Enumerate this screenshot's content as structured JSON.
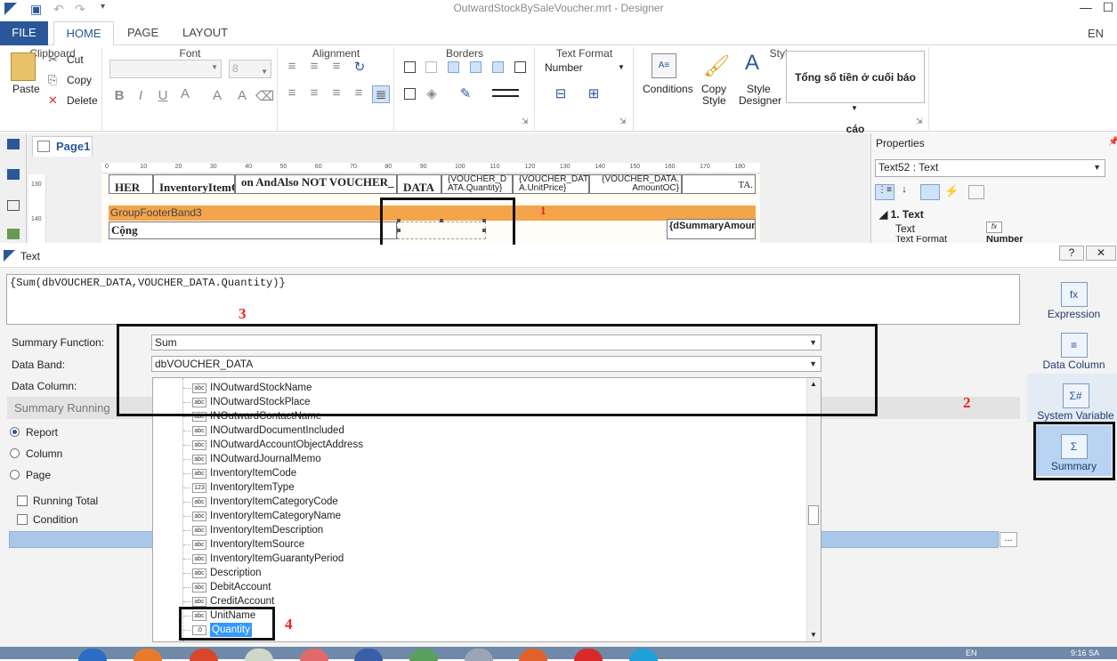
{
  "window": {
    "title": "OutwardStockBySaleVoucher.mrt - Designer",
    "lang": "EN"
  },
  "ribbon": {
    "tabs": [
      {
        "label": "FILE"
      },
      {
        "label": "HOME"
      },
      {
        "label": "PAGE"
      },
      {
        "label": "LAYOUT"
      }
    ],
    "clipboard": {
      "paste": "Paste",
      "cut": "Cut",
      "copy": "Copy",
      "delete": "Delete",
      "group": "Clipboard"
    },
    "font": {
      "size": "8",
      "group": "Font"
    },
    "alignment": {
      "group": "Alignment"
    },
    "borders": {
      "group": "Borders"
    },
    "text_format": {
      "format": "Number",
      "group": "Text Format"
    },
    "style": {
      "conditions": "Conditions",
      "copy_style_1": "Copy",
      "copy_style_2": "Style",
      "style_designer_1": "Style",
      "style_designer_2": "Designer",
      "preview": "Tổng số tiền ở cuối báo cáo",
      "group": "Style"
    }
  },
  "designer": {
    "page_tab": "Page1",
    "ruler": [
      "0",
      "10",
      "20",
      "30",
      "40",
      "50",
      "60",
      "70",
      "80",
      "90",
      "100",
      "110",
      "120",
      "130",
      "140",
      "150",
      "160",
      "170",
      "180"
    ],
    "vruler": [
      "130",
      "140"
    ],
    "header_cells": [
      "HER",
      "InventoryItemC",
      "on AndAlso NOT VOUCHER_",
      "DATA",
      "{VOUCHER_D ATA.Quantity}",
      "{VOUCHER_DAT A.UnitPrice}",
      "{VOUCHER_DATA. AmountOC}",
      "TA."
    ],
    "band_label": "GroupFooterBand3",
    "footer_label": "Cộng",
    "footer_summary": "{dSummaryAmount"
  },
  "properties": {
    "title": "Properties",
    "selected": "Text52 : Text",
    "section": "1. Text",
    "row_text": "Text",
    "row_text_value": "fx",
    "row_format": "Text Format",
    "row_format_value": "Number"
  },
  "dialog": {
    "title": "Text",
    "expression": "{Sum(dbVOUCHER_DATA,VOUCHER_DATA.Quantity)}",
    "summary_function_label": "Summary Function:",
    "summary_function_value": "Sum",
    "data_band_label": "Data Band:",
    "data_band_value": "dbVOUCHER_DATA",
    "data_column_label": "Data Column:",
    "summary_running": "Summary Running",
    "radios": [
      {
        "label": "Report",
        "checked": true
      },
      {
        "label": "Column",
        "checked": false
      },
      {
        "label": "Page",
        "checked": false
      }
    ],
    "checks": [
      {
        "label": "Running Total"
      },
      {
        "label": "Condition"
      }
    ],
    "columns": [
      {
        "name": "INOutwardStockName",
        "icon": "abc"
      },
      {
        "name": "INOutwardStockPlace",
        "icon": "abc"
      },
      {
        "name": "INOutwardContactName",
        "icon": "abc"
      },
      {
        "name": "INOutwardDocumentIncluded",
        "icon": "abc"
      },
      {
        "name": "INOutwardAccountObjectAddress",
        "icon": "abc"
      },
      {
        "name": "INOutwardJournalMemo",
        "icon": "abc"
      },
      {
        "name": "InventoryItemCode",
        "icon": "abc"
      },
      {
        "name": "InventoryItemType",
        "icon": "123"
      },
      {
        "name": "InventoryItemCategoryCode",
        "icon": "abc"
      },
      {
        "name": "InventoryItemCategoryName",
        "icon": "abc"
      },
      {
        "name": "InventoryItemDescription",
        "icon": "abc"
      },
      {
        "name": "InventoryItemSource",
        "icon": "abc"
      },
      {
        "name": "InventoryItemGuarantyPeriod",
        "icon": "abc"
      },
      {
        "name": "Description",
        "icon": "abc"
      },
      {
        "name": "DebitAccount",
        "icon": "abc"
      },
      {
        "name": "CreditAccount",
        "icon": "abc"
      },
      {
        "name": "UnitName",
        "icon": "abc"
      },
      {
        "name": "Quantity",
        "icon": ".0",
        "selected": true
      }
    ],
    "side_buttons": [
      {
        "label": "Expression",
        "icon": "fx"
      },
      {
        "label": "Data Column",
        "icon": "≡"
      },
      {
        "label": "System Variable",
        "icon": "Σ#"
      },
      {
        "label": "Summary",
        "icon": "Σ"
      }
    ],
    "ellipsis": "..."
  },
  "annotations": {
    "n1": "1",
    "n2": "2",
    "n3": "3",
    "n4": "4"
  },
  "taskbar": {
    "time": "9:16 SA",
    "lang": "EN"
  }
}
